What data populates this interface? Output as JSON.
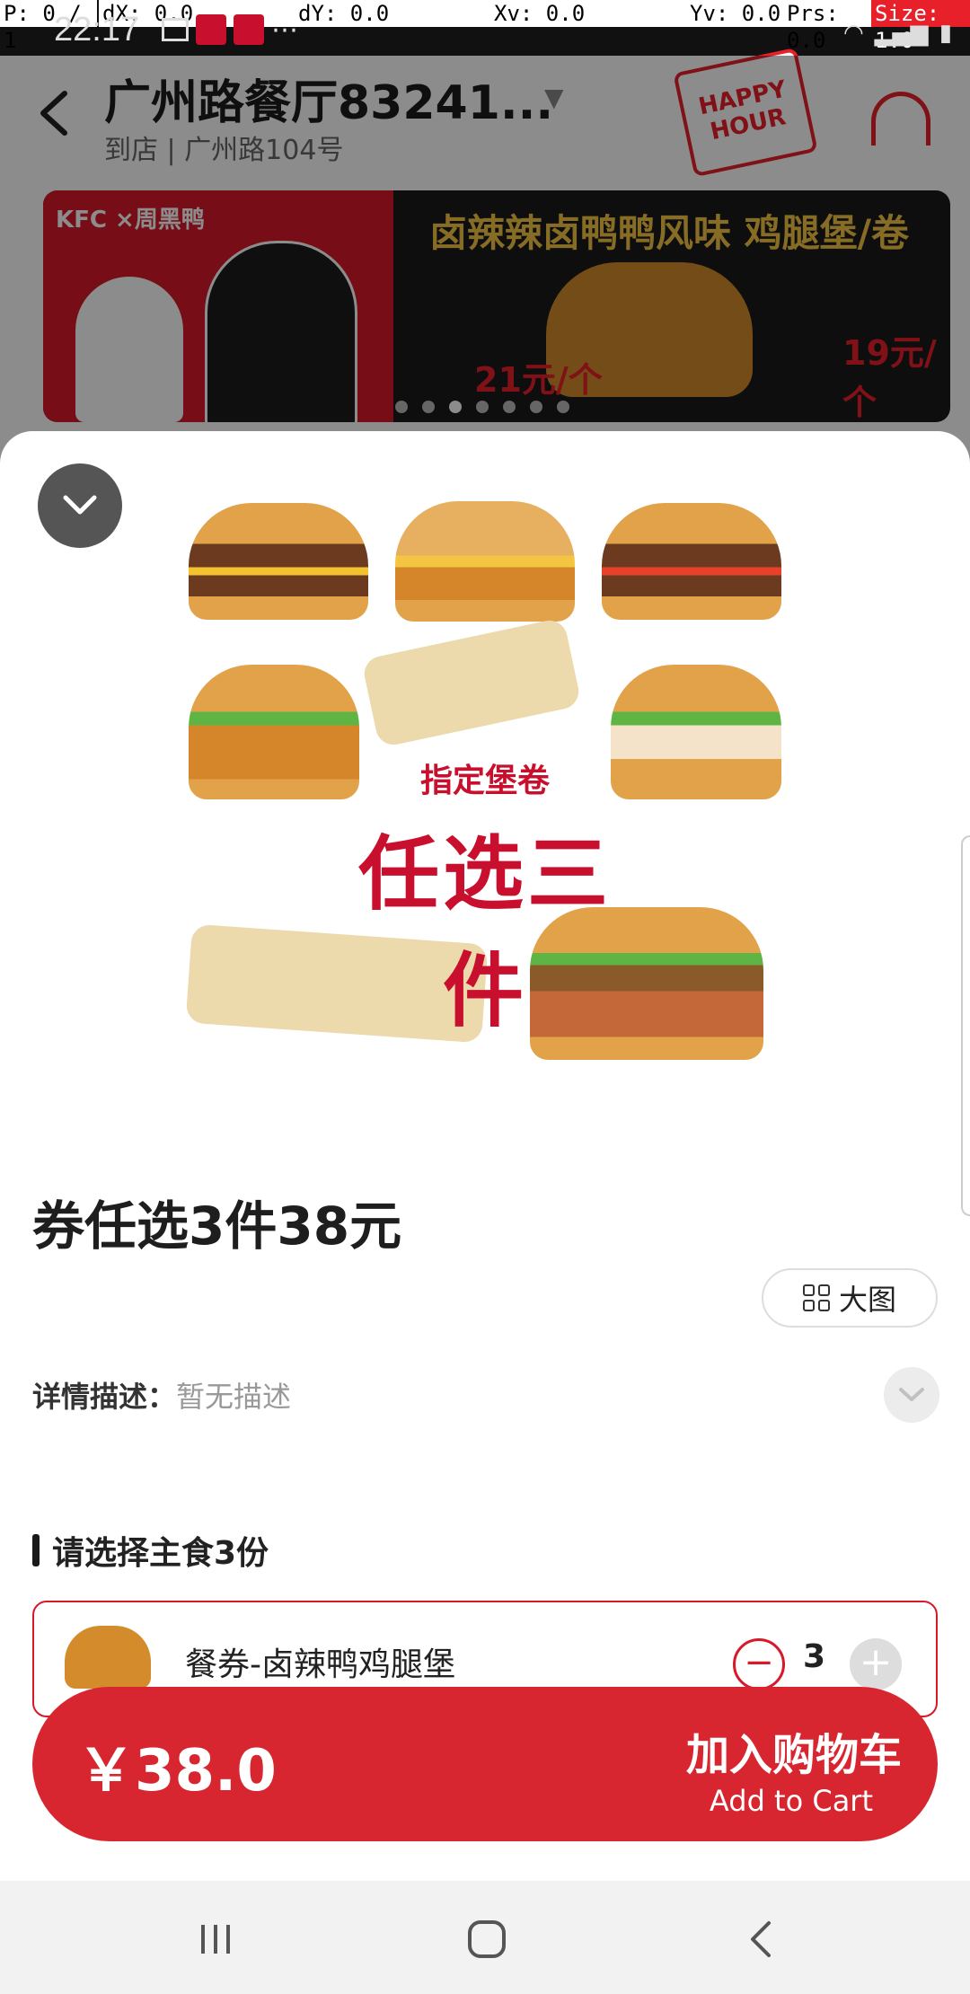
{
  "debug_bar": {
    "p": "P: 0 / 1",
    "dx": "dX: 0.0",
    "dy": "dY: 0.0",
    "xv": "Xv: 0.0",
    "yv": "Yv: 0.0",
    "prs": "Prs: 0.0",
    "size": "Size: 1.0"
  },
  "status": {
    "time": "22:17"
  },
  "header": {
    "back_icon": "chevron-left-icon",
    "store_name": "广州路餐厅83241...",
    "store_sub": "到店 | 广州路104号",
    "happy_hour": "HAPPY HOUR"
  },
  "banner": {
    "brand": "KFC ×周黑鸭",
    "title": "卤辣辣卤鸭鸭风味 鸡腿堡/卷",
    "price_left": "21元/个",
    "price_right": "19元/个"
  },
  "sheet": {
    "promo_line1": "指定堡卷",
    "promo_line2": "任选三件",
    "product_title": "券任选3件38元",
    "big_image_label": "大图",
    "desc_label": "详情描述：",
    "desc_value": "暂无描述",
    "section_title": "请选择主食3份",
    "item": {
      "name": "餐券-卤辣鸭鸡腿堡",
      "qty": "3",
      "minus": "−",
      "plus": "+"
    },
    "price": "￥38.0",
    "cart_cn": "加入购物车",
    "cart_en": "Add to Cart"
  },
  "colors": {
    "accent": "#d7262f",
    "text": "#1e1e1e",
    "muted": "#999999"
  }
}
